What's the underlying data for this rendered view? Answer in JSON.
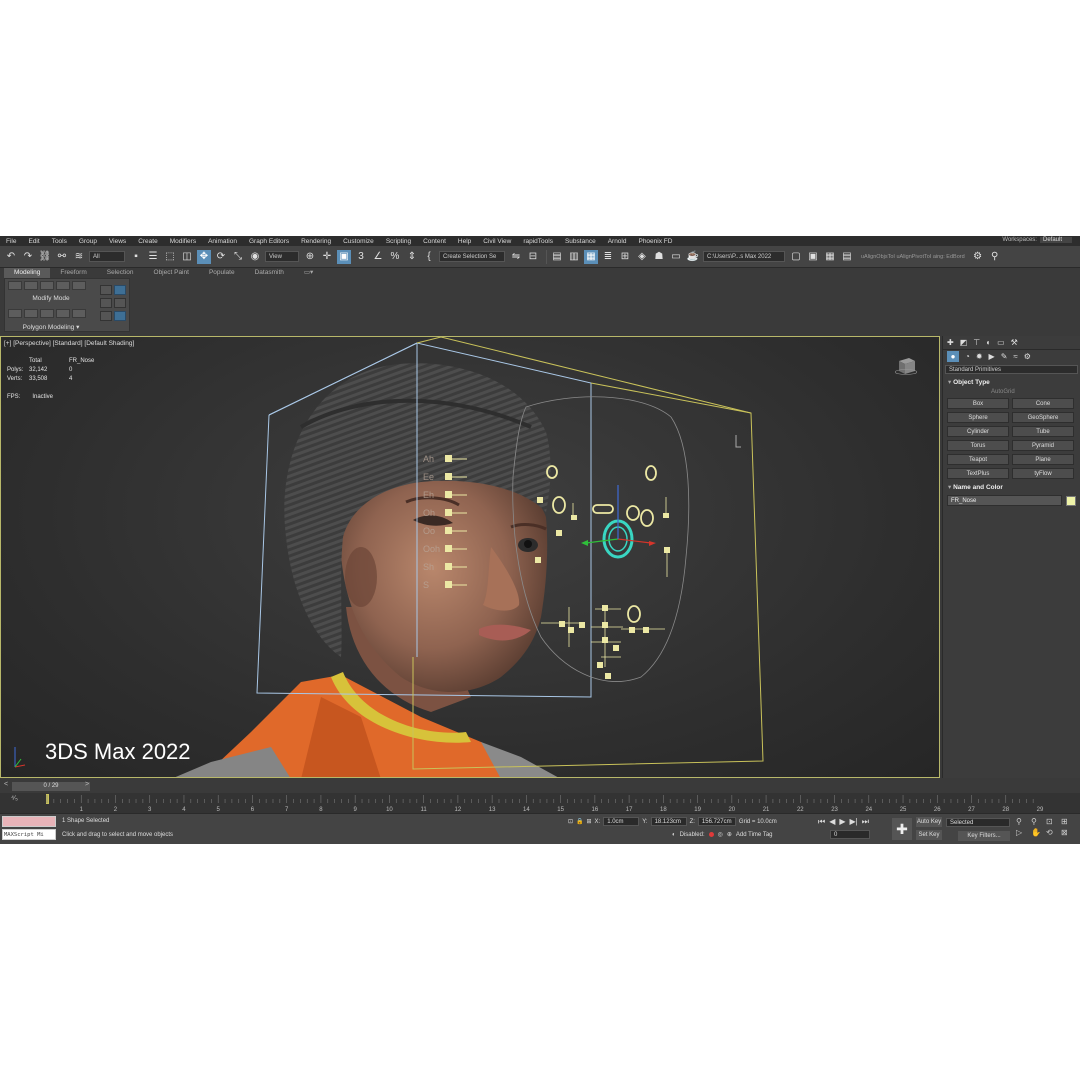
{
  "menu": [
    "File",
    "Edit",
    "Tools",
    "Group",
    "Views",
    "Create",
    "Modifiers",
    "Animation",
    "Graph Editors",
    "Rendering",
    "Customize",
    "Scripting",
    "Content",
    "Help",
    "Civil View",
    "rapidTools",
    "Substance",
    "Arnold",
    "Phoenix FD"
  ],
  "workspace": {
    "label": "Workspaces:",
    "value": "Default"
  },
  "toolbar": {
    "selection_filter": "All",
    "ref_coord": "View",
    "selection_set": "Create Selection Se",
    "project_path": "C:\\Users\\P...s Max 2022",
    "extra_text": "uAlignObjsToI  uAlignPivotToI  aing: EdBord"
  },
  "ribbon": {
    "tabs": [
      "Modeling",
      "Freeform",
      "Selection",
      "Object Paint",
      "Populate",
      "Datasmith"
    ],
    "active_tab": "Modeling",
    "modify_mode": "Modify Mode",
    "polygon_modeling": "Polygon Modeling ▾"
  },
  "viewport": {
    "label": "[+] [Perspective] [Standard] [Default Shading]",
    "stats_header": [
      "",
      "Total",
      "FR_Nose"
    ],
    "stats": [
      {
        "name": "Polys:",
        "total": "32,142",
        "sel": "0"
      },
      {
        "name": "Verts:",
        "total": "33,508",
        "sel": "4"
      }
    ],
    "fps_label": "FPS:",
    "fps_value": "Inactive",
    "watermark": "3DS Max 2022",
    "face_labels": [
      "Ah",
      "Ee",
      "Eh",
      "Oh",
      "Oo",
      "Ooh",
      "Sh",
      "S"
    ]
  },
  "command_panel": {
    "dropdown": "Standard Primitives",
    "object_type_title": "Object Type",
    "autogrid": "AutoGrid",
    "objects": [
      "Box",
      "Cone",
      "Sphere",
      "GeoSphere",
      "Cylinder",
      "Tube",
      "Torus",
      "Pyramid",
      "Teapot",
      "Plane",
      "TextPlus",
      "tyFlow"
    ],
    "name_color_title": "Name and Color",
    "name_value": "FR_Nose",
    "object_color": "#eef3a8"
  },
  "time": {
    "slider_value": "0 / 29",
    "prev": "<",
    "next": ">",
    "ticks": [
      "0",
      "1",
      "2",
      "3",
      "4",
      "5",
      "6",
      "7",
      "8",
      "9",
      "10",
      "11",
      "12",
      "13",
      "14",
      "15",
      "16",
      "17",
      "18",
      "19",
      "20",
      "21",
      "22",
      "23",
      "24",
      "25",
      "26",
      "27",
      "28",
      "29"
    ]
  },
  "status": {
    "maxscript": "MAXScript Mi",
    "selected": "1 Shape Selected",
    "hint": "Click and drag to select and move objects",
    "x_label": "X:",
    "x": "1.0cm",
    "y_label": "Y:",
    "y": "18.123cm",
    "z_label": "Z:",
    "z": "156.727cm",
    "grid": "Grid = 10.0cm",
    "disabled": "Disabled:",
    "add_time_tag": "Add Time Tag",
    "auto_key": "Auto Key",
    "set_key": "Set Key",
    "selected_dd": "Selected",
    "key_filters": "Key Filters...",
    "frame": "0"
  },
  "colors": {
    "accent": "#5b8fb8",
    "viewport_border": "#b8b86a",
    "wire_yellow": "#c9c25a",
    "wire_blue": "#a9c7e6",
    "rig_box": "#ece8a4",
    "selected_ring": "#39d6c2"
  }
}
